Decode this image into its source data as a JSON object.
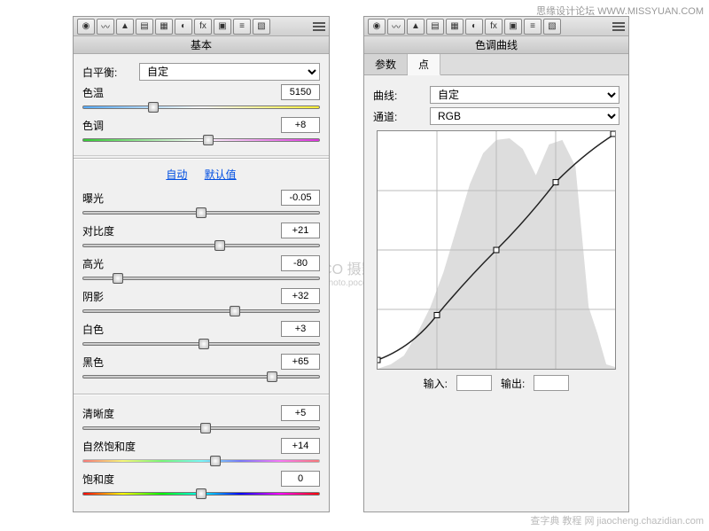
{
  "watermarks": {
    "top_right": "思缘设计论坛  WWW.MISSYUAN.COM",
    "bottom_right": "查字典  教程 网  jiaocheng.chazidian.com",
    "center_main": "POCO 摄影专题",
    "center_sub": "http://photo.poco.cn/"
  },
  "toolbar_icons": [
    "aperture",
    "curve",
    "triangle",
    "histogram",
    "detail",
    "lens",
    "fx",
    "camera",
    "sliders",
    "presets"
  ],
  "basic": {
    "title": "基本",
    "wb_label": "白平衡:",
    "wb_value": "自定",
    "temp_label": "色温",
    "temp_value": "5150",
    "temp_pos": 30,
    "tint_label": "色调",
    "tint_value": "+8",
    "tint_pos": 53,
    "auto": "自动",
    "default": "默认值",
    "exposure_label": "曝光",
    "exposure_value": "-0.05",
    "exposure_pos": 50,
    "contrast_label": "对比度",
    "contrast_value": "+21",
    "contrast_pos": 58,
    "highlights_label": "高光",
    "highlights_value": "-80",
    "highlights_pos": 15,
    "shadows_label": "阴影",
    "shadows_value": "+32",
    "shadows_pos": 64,
    "whites_label": "白色",
    "whites_value": "+3",
    "whites_pos": 51,
    "blacks_label": "黑色",
    "blacks_value": "+65",
    "blacks_pos": 80,
    "clarity_label": "清晰度",
    "clarity_value": "+5",
    "clarity_pos": 52,
    "vibrance_label": "自然饱和度",
    "vibrance_value": "+14",
    "vibrance_pos": 56,
    "saturation_label": "饱和度",
    "saturation_value": "0",
    "saturation_pos": 50
  },
  "curves": {
    "title": "色调曲线",
    "tab_param": "参数",
    "tab_point": "点",
    "curve_label": "曲线:",
    "curve_value": "自定",
    "channel_label": "通道:",
    "channel_value": "RGB",
    "input_label": "输入:",
    "output_label": "输出:"
  },
  "chart_data": {
    "type": "line",
    "title": "色调曲线",
    "xlabel": "输入",
    "ylabel": "输出",
    "xlim": [
      0,
      255
    ],
    "ylim": [
      0,
      255
    ],
    "series": [
      {
        "name": "RGB曲线",
        "x": [
          0,
          32,
          64,
          128,
          192,
          224,
          255
        ],
        "y": [
          10,
          28,
          58,
          128,
          200,
          230,
          252
        ]
      }
    ],
    "histogram_notes": "背景灰色直方图显示中间调为主的分布，两端少量，高光附近有小峰"
  }
}
